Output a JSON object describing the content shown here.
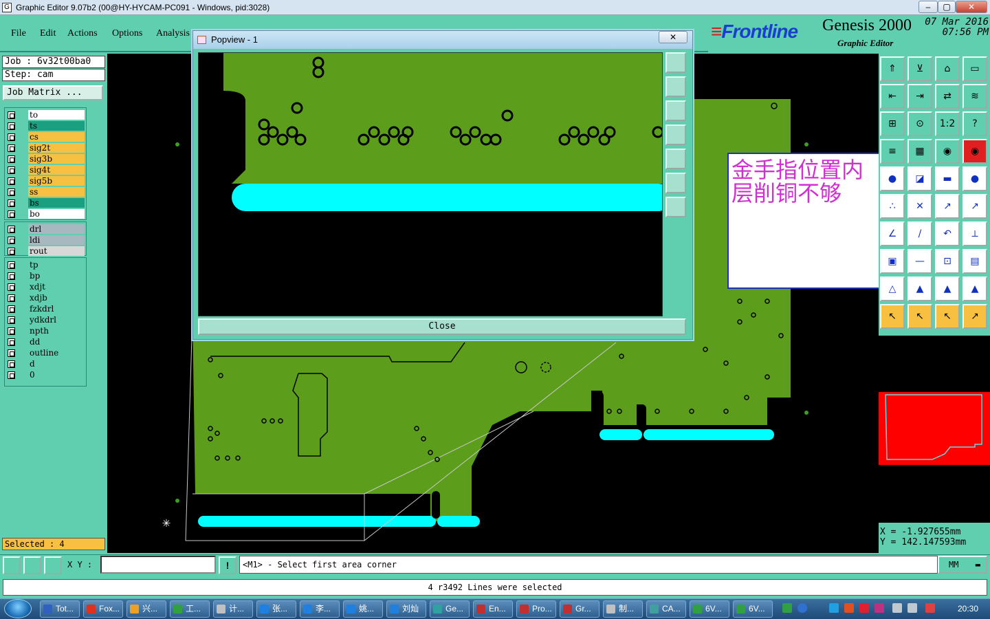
{
  "window": {
    "title": "Graphic Editor 9.07b2 (00@HY-HYCAM-PC091 - Windows, pid:3028)"
  },
  "menu": [
    "File",
    "Edit",
    "Actions",
    "Options",
    "Analysis"
  ],
  "header": {
    "brand": "Frontline",
    "product": "Genesis 2000",
    "subtitle": "Graphic Editor",
    "date": "07 Mar 2016",
    "time": "07:56 PM"
  },
  "job": {
    "job_label": "Job : 6v32t00ba0",
    "step_label": "Step: cam",
    "matrix_button": "Job Matrix ..."
  },
  "layers": {
    "group1": [
      {
        "name": "to",
        "color": "#ffffff"
      },
      {
        "name": "ts",
        "color": "#1aa080"
      },
      {
        "name": "cs",
        "color": "#f8c040"
      },
      {
        "name": "sig2t",
        "color": "#f8c040"
      },
      {
        "name": "sig3b",
        "color": "#f8c040"
      },
      {
        "name": "sig4t",
        "color": "#f8c040"
      },
      {
        "name": "sig5b",
        "color": "#f8c040"
      },
      {
        "name": "ss",
        "color": "#f8c040"
      },
      {
        "name": "bs",
        "color": "#1aa080"
      },
      {
        "name": "bo",
        "color": "#ffffff"
      }
    ],
    "group2": [
      {
        "name": "drl",
        "color": "#a8b8c0"
      },
      {
        "name": "ldi",
        "color": "#a8b8c0"
      },
      {
        "name": "rout",
        "color": "#d8d8d8"
      }
    ],
    "group3": [
      {
        "name": "tp",
        "color": "#5fcfb0"
      },
      {
        "name": "bp",
        "color": "#5fcfb0"
      },
      {
        "name": "xdjt",
        "color": "#5fcfb0"
      },
      {
        "name": "xdjb",
        "color": "#5fcfb0"
      },
      {
        "name": "fzkdrl",
        "color": "#5fcfb0"
      },
      {
        "name": "ydkdrl",
        "color": "#5fcfb0"
      },
      {
        "name": "npth",
        "color": "#5fcfb0"
      },
      {
        "name": "dd",
        "color": "#5fcfb0"
      },
      {
        "name": "outline",
        "color": "#5fcfb0"
      },
      {
        "name": "d",
        "color": "#5fcfb0"
      },
      {
        "name": "0",
        "color": "#5fcfb0"
      }
    ]
  },
  "selected_label": "Selected : 4",
  "popview": {
    "title": "Popview - 1",
    "close_label": "Close"
  },
  "annotation": {
    "text": "金手指位置内层削铜不够"
  },
  "coords": {
    "x": "X = -1.927655mm",
    "y": "Y = 142.147593mm"
  },
  "bottom": {
    "xy_label": "X Y :",
    "xy_value": "",
    "prompt": "<M1> - Select first area corner",
    "units": "MM",
    "status": "4 r3492 Lines were selected"
  },
  "taskbar": {
    "items": [
      {
        "label": "Tot...",
        "color": "#3060c0"
      },
      {
        "label": "Fox...",
        "color": "#e03020"
      },
      {
        "label": "兴...",
        "color": "#f0a020"
      },
      {
        "label": "工...",
        "color": "#30a040"
      },
      {
        "label": "计...",
        "color": "#c0c0c0"
      },
      {
        "label": "张...",
        "color": "#2080e0"
      },
      {
        "label": "李...",
        "color": "#2080e0"
      },
      {
        "label": "姚...",
        "color": "#2080e0"
      },
      {
        "label": "刘灿",
        "color": "#2080e0"
      },
      {
        "label": "Ge...",
        "color": "#30a0a0"
      },
      {
        "label": "En...",
        "color": "#c03030"
      },
      {
        "label": "Pro...",
        "color": "#c03030"
      },
      {
        "label": "Gr...",
        "color": "#c03030"
      },
      {
        "label": "制...",
        "color": "#c0c0c0"
      },
      {
        "label": "CA...",
        "color": "#40a0a0"
      },
      {
        "label": "6V...",
        "color": "#30a040"
      },
      {
        "label": "6V...",
        "color": "#30a040"
      }
    ],
    "clock": "20:30"
  },
  "colors": {
    "panel": "#5fcfb0",
    "copper": "#5c9e1c",
    "finger": "#00ffff",
    "board_outline": "#ff0000"
  }
}
